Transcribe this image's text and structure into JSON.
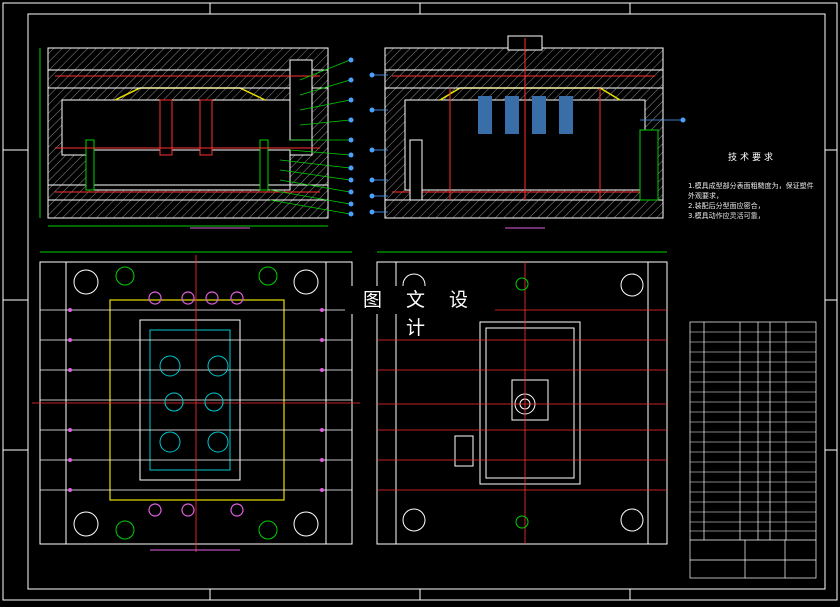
{
  "watermark": "图 文 设 计",
  "tech_notes": {
    "title": "技术要求",
    "items": [
      "1.模具成型部分表面粗糙度为，保证塑件外观要求，",
      "2.装配后分型面应密合，",
      "3.模具动作应灵活可靠，"
    ]
  },
  "colors": {
    "background": "#000000",
    "outline": "#ffffff",
    "hatch": "#8a8a8a",
    "green": "#00d000",
    "red": "#ff3030",
    "blue": "#4aa0ff",
    "magenta": "#e060e0",
    "cyan": "#00c8d0",
    "yellow": "#e8e000"
  }
}
